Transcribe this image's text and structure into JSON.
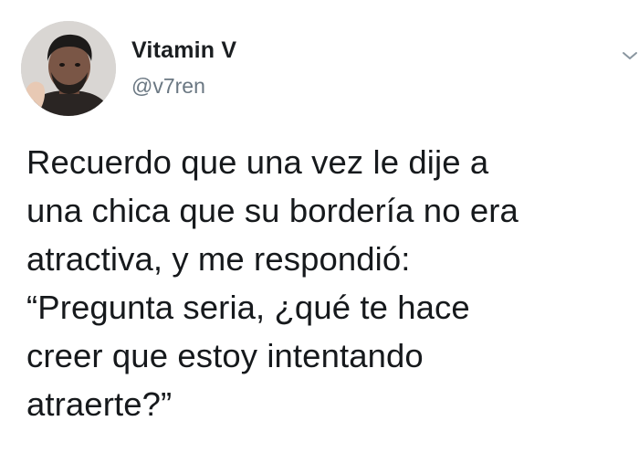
{
  "tweet": {
    "display_name": "Vitamin V",
    "handle": "@v7ren",
    "text": "Recuerdo que una vez le dije a\nuna chica que su bordería no era\natractiva, y me respondió:\n“Pregunta seria, ¿qué te hace\ncreer que estoy intentando\natraerte?”"
  },
  "icons": {
    "avatar": "user-avatar",
    "menu": "chevron-down-icon"
  },
  "colors": {
    "background": "#ffffff",
    "text": "#14171a",
    "handle": "#6a7782"
  }
}
